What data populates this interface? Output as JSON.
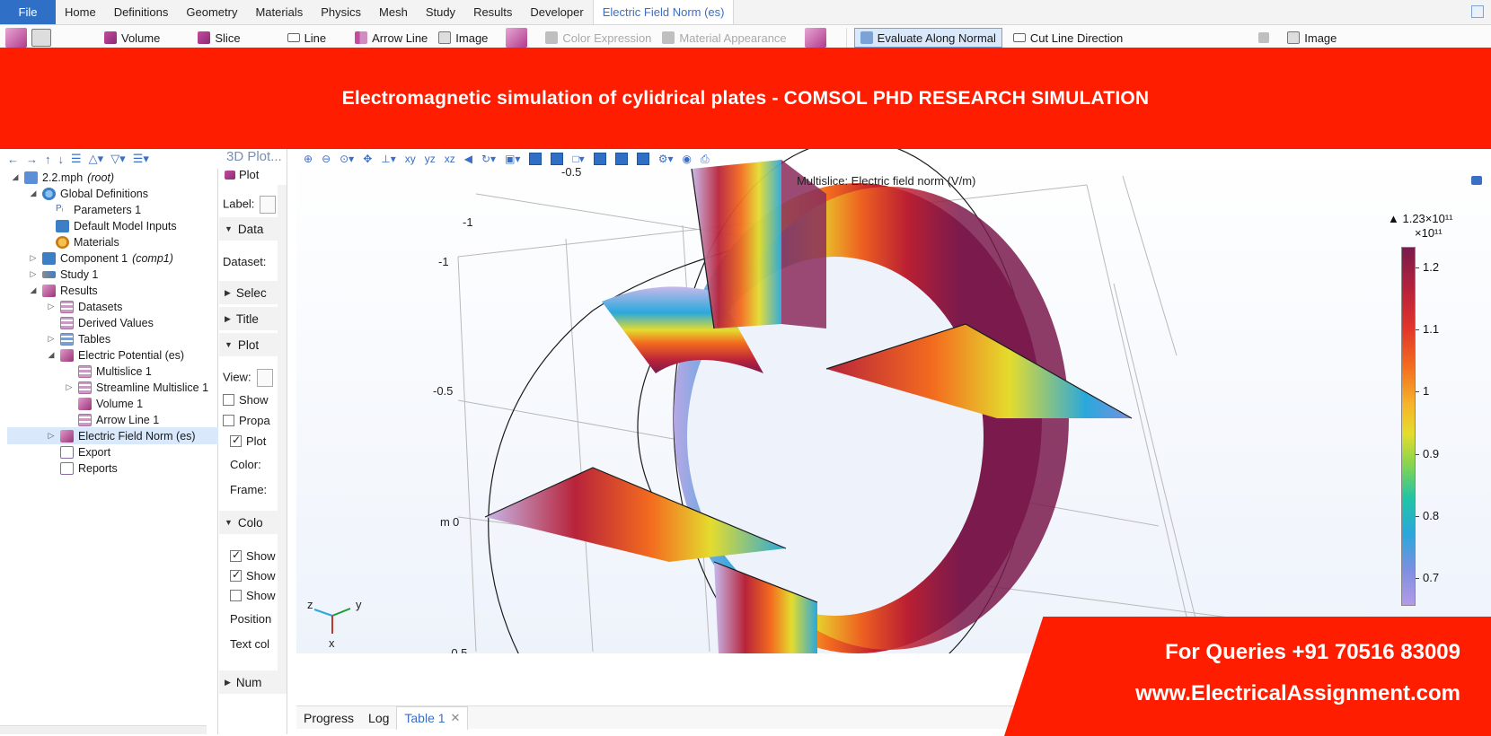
{
  "ribbon": {
    "file_tab": "File",
    "tabs": [
      "Home",
      "Definitions",
      "Geometry",
      "Materials",
      "Physics",
      "Mesh",
      "Study",
      "Results",
      "Developer"
    ],
    "context_tab": "Electric Field Norm (es)",
    "tools": {
      "volume": "Volume",
      "slice": "Slice",
      "line": "Line",
      "arrow_line": "Arrow Line",
      "image": "Image",
      "color_expression": "Color Expression",
      "material_appearance": "Material Appearance",
      "evaluate_along_normal": "Evaluate Along Normal",
      "cut_line_direction": "Cut Line Direction",
      "image2": "Image"
    }
  },
  "banner": {
    "title": "Electromagnetic simulation of cylidrical plates - COMSOL PHD RESEARCH SIMULATION"
  },
  "tree": {
    "root_name": "2.2.mph",
    "root_tag": "(root)",
    "global_definitions": "Global Definitions",
    "parameters": "Parameters 1",
    "default_inputs": "Default Model Inputs",
    "materials": "Materials",
    "component": "Component 1",
    "component_tag": "(comp1)",
    "study": "Study 1",
    "results": "Results",
    "datasets": "Datasets",
    "derived_values": "Derived Values",
    "tables": "Tables",
    "electric_potential": "Electric Potential (es)",
    "multislice": "Multislice 1",
    "streamline_multislice": "Streamline Multislice 1",
    "volume": "Volume 1",
    "arrow_line": "Arrow Line 1",
    "electric_field_norm": "Electric Field Norm (es)",
    "export": "Export",
    "reports": "Reports"
  },
  "settings": {
    "title": "3D Plot...",
    "plot_button": "Plot",
    "label": "Label:",
    "data_section": "Data",
    "dataset": "Dataset:",
    "selection_section": "Selec",
    "title_section": "Title",
    "plot_section": "Plot",
    "view": "View:",
    "show": "Show",
    "propagate": "Propa",
    "plot_data": "Plot",
    "color": "Color:",
    "frame": "Frame:",
    "color_section": "Colo",
    "show1": "Show",
    "show2": "Show",
    "show3": "Show",
    "position": "Position",
    "text_color": "Text col",
    "number_section": "Num"
  },
  "graphics": {
    "plot_title": "Multislice: Electric field norm (V/m)",
    "axis_labels": {
      "top": "-0.5",
      "neg1a": "-1",
      "neg1b": "-1",
      "neg05": "-0.5",
      "zero": "0",
      "unit": "m",
      "bottom": "-0.5"
    },
    "triad": {
      "z": "z",
      "y": "y",
      "x": "x"
    }
  },
  "colorbar": {
    "max_label": "▲ 1.23×10¹¹",
    "unit_label": "×10¹¹",
    "ticks": [
      "1.2",
      "1.1",
      "1",
      "0.9",
      "0.8",
      "0.7"
    ]
  },
  "bottom_tabs": {
    "progress": "Progress",
    "log": "Log",
    "table": "Table 1"
  },
  "contact": {
    "phone": "For Queries +91 70516 83009",
    "website": "www.ElectricalAssignment.com"
  }
}
